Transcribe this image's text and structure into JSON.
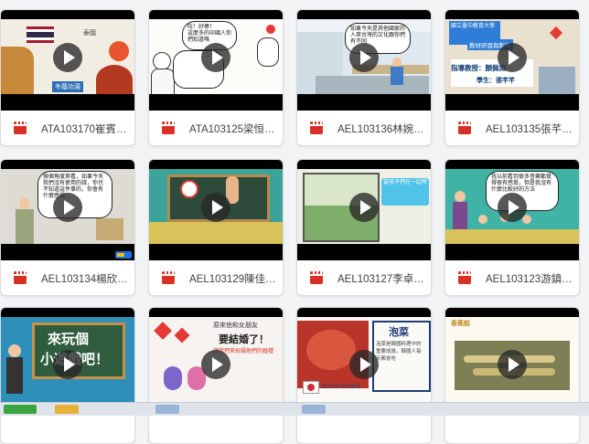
{
  "files": [
    {
      "name": "ATA103170崔賓…",
      "t1": "泰國",
      "t2": "冬蔭功湯"
    },
    {
      "name": "ATA103125梁恒…",
      "t1": "哇！好棒！",
      "t2": "這麼多的中國人你們知道嗎"
    },
    {
      "name": "AEL103136林婉…",
      "t1": "如果今天是其他國家的人來台灣的文化跟你們有不同"
    },
    {
      "name": "AEL103135張芊…",
      "t1": "國立臺中教育大學",
      "t2": "教材研發與製作",
      "t3": "指導教授：顏佩如",
      "t4": "學生：張芊芊"
    },
    {
      "name": "AEL103134楊欣…",
      "t1": "換個角度來看，如果今天我們沒有使用的錢，你也不知道這件事的，你會有什麼感受"
    },
    {
      "name": "AEL103129陳佳…"
    },
    {
      "name": "AEL103127李卓…",
      "t1": "當孩子們在一起時"
    },
    {
      "name": "AEL103123游鎮…",
      "t1": "我以前看到很多音樂都覺得很有感覺，但是我沒有什麼比較好的方法"
    },
    {
      "name": "",
      "t1": "來玩個",
      "t2": "小遊戲吧！"
    },
    {
      "name": "",
      "t1": "原來他和女朋友",
      "t2": "要結婚了！",
      "t3": "讓我們來祝福他們的婚禮"
    },
    {
      "name": "",
      "t1": "泡菜",
      "t2": "SOUTH KOREA",
      "t3": "泡菜是韓國料理中的重要成員，韓國人每天都會吃"
    },
    {
      "name": "",
      "t1": "香蕉船"
    }
  ],
  "colors": {
    "accent": "#d93025",
    "bg": "#f1f3f4"
  }
}
